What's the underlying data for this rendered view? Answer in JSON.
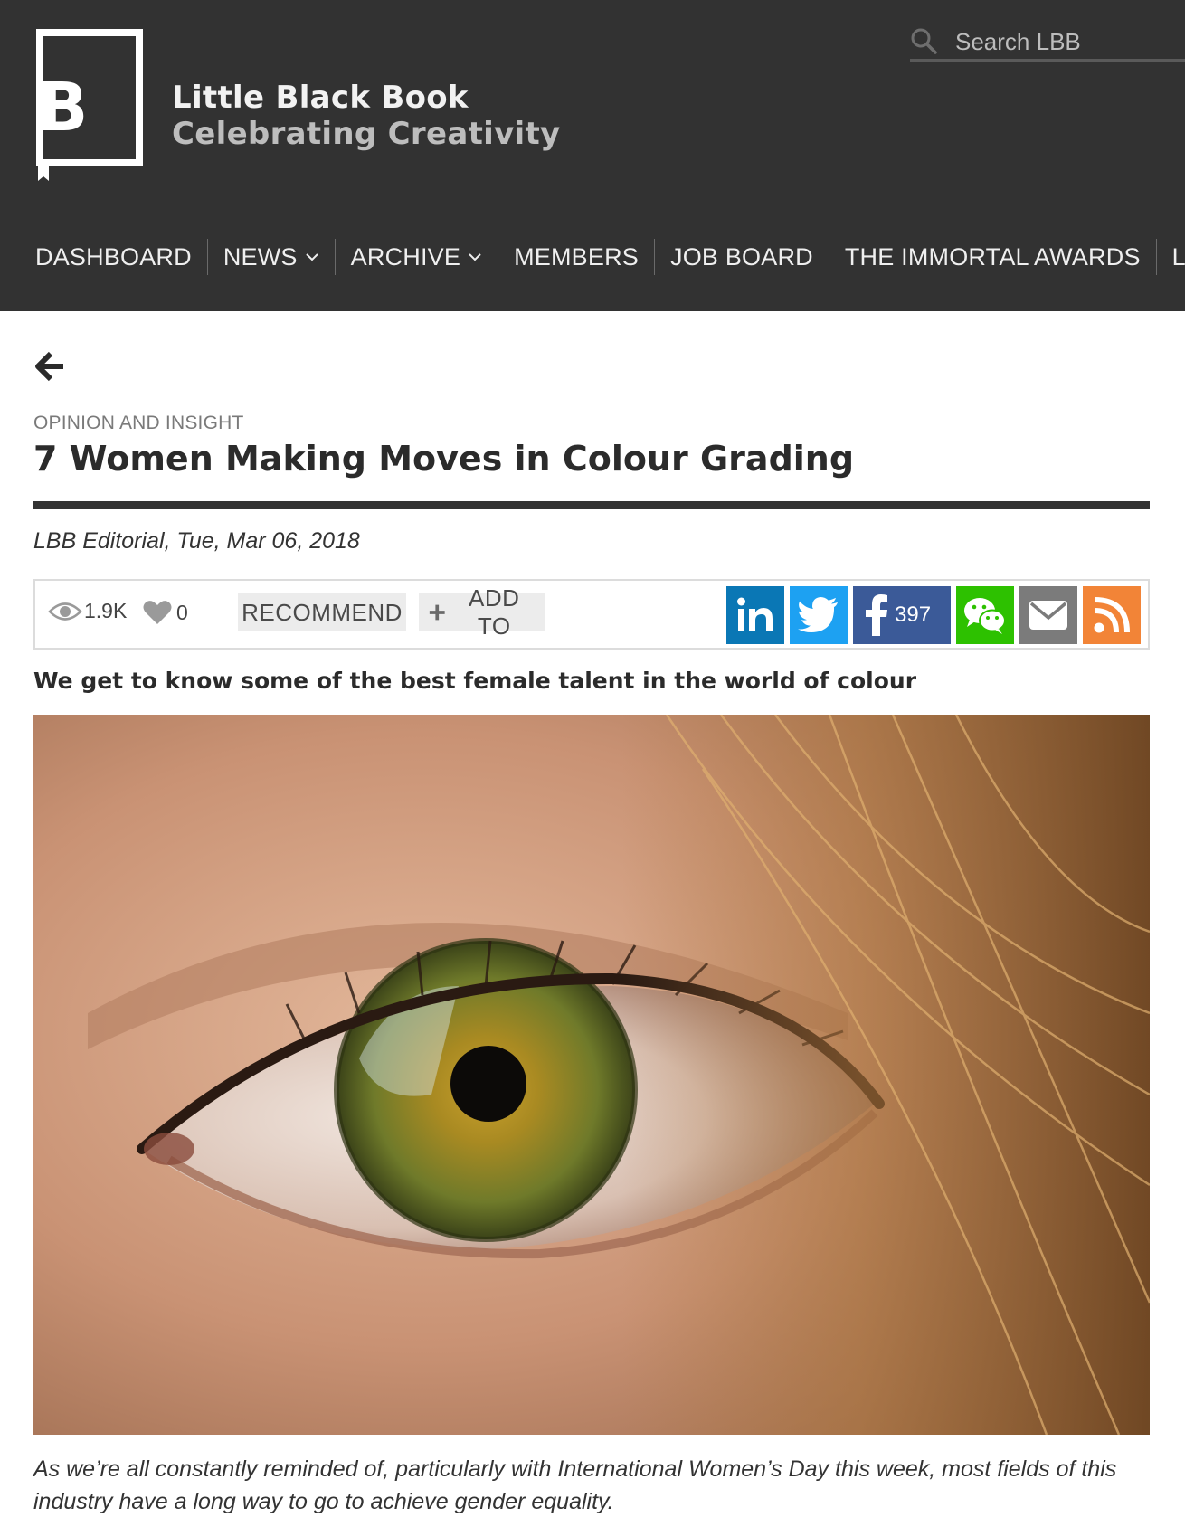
{
  "header": {
    "brand_title": "Little Black Book",
    "brand_subtitle": "Celebrating Creativity",
    "logo_letter": "B",
    "search": {
      "placeholder": "Search LBB",
      "icon": "search-icon"
    },
    "nav": [
      {
        "label": "DASHBOARD",
        "has_dropdown": false
      },
      {
        "label": "NEWS",
        "has_dropdown": true
      },
      {
        "label": "ARCHIVE",
        "has_dropdown": true
      },
      {
        "label": "MEMBERS",
        "has_dropdown": false
      },
      {
        "label": "JOB BOARD",
        "has_dropdown": false
      },
      {
        "label": "THE IMMORTAL AWARDS",
        "has_dropdown": false
      },
      {
        "label": "LEAGUE TAB",
        "has_dropdown": false
      }
    ]
  },
  "article": {
    "category": "OPINION AND INSIGHT",
    "title": "7 Women Making Moves in Colour Grading",
    "byline": "LBB Editorial, Tue, Mar 06, 2018",
    "views": "1.9K",
    "likes": "0",
    "recommend_label": "RECOMMEND",
    "add_to_label": "ADD TO",
    "share": {
      "linkedin_icon": "linkedin-icon",
      "twitter_icon": "twitter-icon",
      "facebook_icon": "facebook-icon",
      "facebook_count": "397",
      "wechat_icon": "wechat-icon",
      "email_icon": "email-icon",
      "rss_icon": "rss-icon"
    },
    "standfirst": "We get to know some of the best female talent in the world of colour",
    "intro": "As we’re all constantly reminded of, particularly with International Women’s Day this week, most fields of this industry have a long way to go to achieve gender equality."
  },
  "colors": {
    "header_bg": "#323232",
    "linkedin": "#0a77b5",
    "twitter": "#1da1f2",
    "facebook": "#3b5a98",
    "wechat": "#2dc100",
    "email": "#7b7b7b",
    "rss": "#f28437"
  }
}
